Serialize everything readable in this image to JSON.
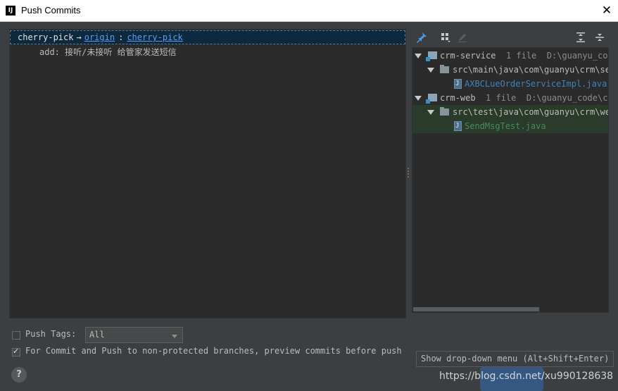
{
  "window": {
    "title": "Push Commits",
    "app_icon": "intellij-icon",
    "close_icon": "close-icon"
  },
  "commits_panel": {
    "local_branch": "cherry-pick",
    "arrow": "→",
    "remote": "origin",
    "separator": ":",
    "remote_branch": "cherry-pick",
    "commit_message": "add: 接听/未接听 给管家发送短信"
  },
  "toolbar": {
    "icons": [
      "pin-icon",
      "group-by-icon",
      "edit-icon",
      "expand-all-icon",
      "collapse-all-icon"
    ]
  },
  "changes_tree": {
    "modules": [
      {
        "name": "crm-service",
        "count": "1 file",
        "path": "D:\\guanyu_code",
        "dir": "src\\main\\java\\com\\guanyu\\crm\\ser",
        "file": "AXBCLueOrderServiceImpl.java"
      },
      {
        "name": "crm-web",
        "count": "1 file",
        "path": "D:\\guanyu_code\\crm",
        "dir": "src\\test\\java\\com\\guanyu\\crm\\web",
        "file": "SendMsgTest.java"
      }
    ]
  },
  "options": {
    "push_tags_label": "Push Tags:",
    "push_tags_checked": false,
    "push_tags_value": "All",
    "preview_label": "For Commit and Push to non-protected branches, preview commits before push",
    "preview_checked": true
  },
  "help_label": "?",
  "tooltip": "Show drop-down menu (Alt+Shift+Enter)",
  "watermark": "https://blog.csdn.net/xu990128638",
  "colors": {
    "accent": "#365880",
    "selection": "#0d293e",
    "link": "#589df6"
  }
}
